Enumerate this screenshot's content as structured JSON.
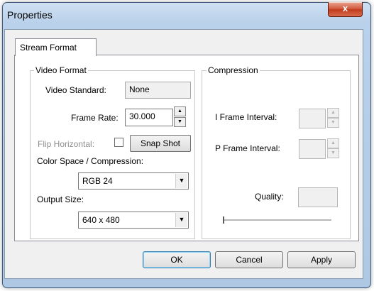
{
  "window": {
    "title": "Properties",
    "close_label": "x"
  },
  "tabs": [
    {
      "label": "Stream Format"
    }
  ],
  "video_format": {
    "group_label": "Video Format",
    "video_standard_label": "Video Standard:",
    "video_standard_value": "None",
    "frame_rate_label": "Frame Rate:",
    "frame_rate_value": "30.000",
    "flip_horizontal_label": "Flip Horizontal:",
    "snap_shot_label": "Snap Shot",
    "color_space_label": "Color Space / Compression:",
    "color_space_value": "RGB 24",
    "output_size_label": "Output Size:",
    "output_size_value": "640 x 480"
  },
  "compression": {
    "group_label": "Compression",
    "i_frame_label": "I Frame Interval:",
    "i_frame_value": "",
    "p_frame_label": "P Frame Interval:",
    "p_frame_value": "",
    "quality_label": "Quality:",
    "quality_value": "",
    "quality_slider": 0
  },
  "footer": {
    "ok_label": "OK",
    "cancel_label": "Cancel",
    "apply_label": "Apply"
  },
  "icons": {
    "spin_up": "▲",
    "spin_down": "▼",
    "dropdown": "▼"
  }
}
